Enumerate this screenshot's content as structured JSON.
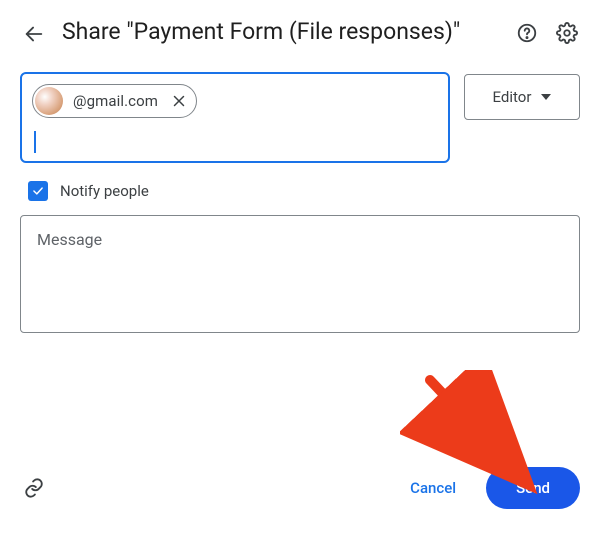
{
  "header": {
    "title": "Share \"Payment Form (File responses)\""
  },
  "people": {
    "chips": [
      {
        "email": "@gmail.com"
      }
    ]
  },
  "role": {
    "selected": "Editor"
  },
  "notify": {
    "checked": true,
    "label": "Notify people"
  },
  "message": {
    "placeholder": "Message"
  },
  "footer": {
    "cancel": "Cancel",
    "send": "Send"
  }
}
